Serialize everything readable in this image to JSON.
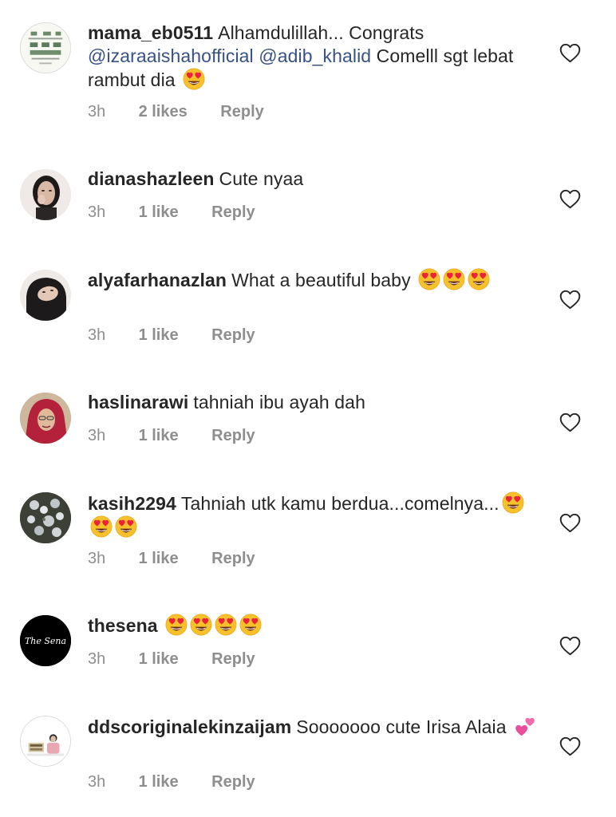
{
  "comments": [
    {
      "username": "mama_eb0511",
      "parts": [
        {
          "type": "text",
          "text": "Alhamdulillah... Congrats "
        },
        {
          "type": "mention",
          "text": "@izaraaishahofficial"
        },
        {
          "type": "text",
          "text": " "
        },
        {
          "type": "mention",
          "text": "@adib_khalid"
        },
        {
          "type": "text",
          "text": "  Comelll sgt lebat rambut dia "
        },
        {
          "type": "emoji",
          "name": "heart-eyes-emoji"
        }
      ],
      "time": "3h",
      "likes": "2 likes",
      "reply": "Reply",
      "avatar": "avatar-certificate"
    },
    {
      "username": "dianashazleen",
      "parts": [
        {
          "type": "text",
          "text": "Cute nyaa"
        }
      ],
      "time": "3h",
      "likes": "1 like",
      "reply": "Reply",
      "avatar": "avatar-photo-woman"
    },
    {
      "username": "alyafarhanazlan",
      "parts": [
        {
          "type": "text",
          "text": "What a beautiful baby "
        },
        {
          "type": "emoji",
          "name": "heart-eyes-emoji"
        },
        {
          "type": "emoji",
          "name": "heart-eyes-emoji"
        },
        {
          "type": "emoji",
          "name": "heart-eyes-emoji"
        }
      ],
      "time": "3h",
      "likes": "1 like",
      "reply": "Reply",
      "avatar": "avatar-photo-hijab"
    },
    {
      "username": "haslinarawi",
      "parts": [
        {
          "type": "text",
          "text": "tahniah ibu ayah dah"
        }
      ],
      "time": "3h",
      "likes": "1 like",
      "reply": "Reply",
      "avatar": "avatar-photo-red-hijab"
    },
    {
      "username": "kasih2294",
      "parts": [
        {
          "type": "text",
          "text": "Tahniah utk kamu berdua...comelnya..."
        },
        {
          "type": "emoji",
          "name": "heart-eyes-emoji"
        },
        {
          "type": "emoji",
          "name": "heart-eyes-emoji"
        },
        {
          "type": "emoji",
          "name": "heart-eyes-emoji"
        }
      ],
      "time": "3h",
      "likes": "1 like",
      "reply": "Reply",
      "avatar": "avatar-photo-flowers"
    },
    {
      "username": "thesena",
      "parts": [
        {
          "type": "emoji",
          "name": "heart-eyes-emoji"
        },
        {
          "type": "emoji",
          "name": "heart-eyes-emoji"
        },
        {
          "type": "emoji",
          "name": "heart-eyes-emoji"
        },
        {
          "type": "emoji",
          "name": "heart-eyes-emoji"
        }
      ],
      "time": "3h",
      "likes": "1 like",
      "reply": "Reply",
      "avatar": "avatar-logo-the-sena",
      "avatar_text": "The Sena"
    },
    {
      "username": "ddscoriginalekinzaijam",
      "parts": [
        {
          "type": "text",
          "text": "Sooooooo cute Irisa Alaia "
        },
        {
          "type": "emoji",
          "name": "two-hearts-emoji"
        }
      ],
      "time": "3h",
      "likes": "1 like",
      "reply": "Reply",
      "avatar": "avatar-product-photo"
    }
  ],
  "colors": {
    "text": "#262626",
    "mention": "#385185",
    "meta": "#8e8e8e"
  }
}
